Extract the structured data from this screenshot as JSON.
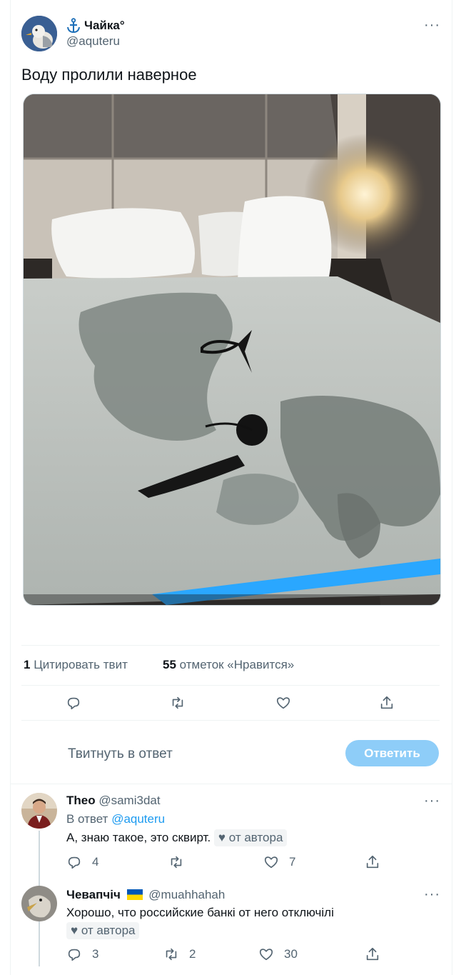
{
  "tweet": {
    "author_name": "Чайка°",
    "author_handle": "@aquteru",
    "text": "Воду пролили наверное",
    "quote_count": "1",
    "quote_label": "Цитировать твит",
    "like_count": "55",
    "like_label": "отметок «Нравится»",
    "more_label": "···"
  },
  "composer": {
    "placeholder": "Твитнуть в ответ",
    "button_label": "Ответить"
  },
  "replies": [
    {
      "name": "Theo",
      "handle": "@sami3dat",
      "reply_prefix": "В ответ",
      "reply_to": "@aquteru",
      "text": "А, знаю такое, это сквирт.",
      "author_like": "♥ от автора",
      "replies": "4",
      "retweets": "",
      "likes": "7",
      "more_label": "···"
    },
    {
      "name": "Чевапчіч",
      "flag": "🇺🇦",
      "handle": "@muahhahah",
      "text": "Хорошо, что российские банкі от него отключілі",
      "author_like": "♥ от автора",
      "replies": "3",
      "retweets": "2",
      "likes": "30",
      "more_label": "···"
    }
  ],
  "colors": {
    "accent": "#1d9bf0",
    "reply_button_bg": "#8ecdf8",
    "muted": "#536471",
    "divider": "#eff3f4"
  },
  "icons": [
    "anchor-icon",
    "reply-icon",
    "retweet-icon",
    "like-icon",
    "share-icon",
    "more-icon"
  ]
}
